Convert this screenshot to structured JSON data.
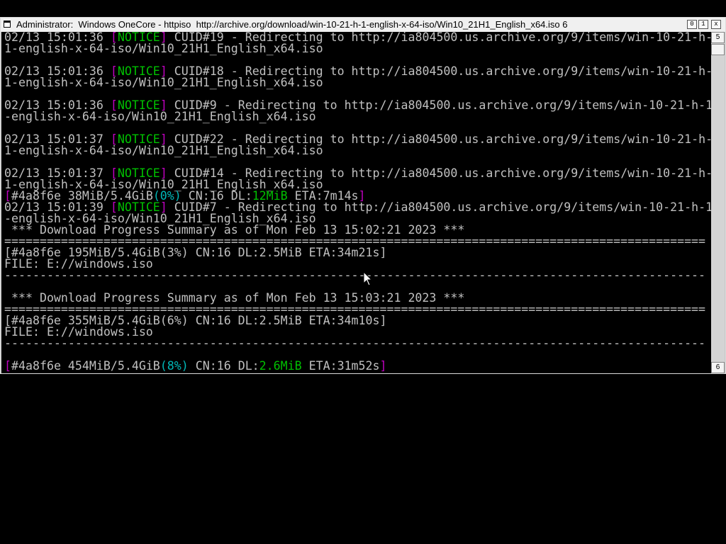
{
  "window": {
    "title": "Administrator:  Windows OneCore - httpiso  http://archive.org/download/win-10-21-h-1-english-x-64-iso/Win10_21H1_English_x64.iso 6",
    "buttons": {
      "minimize": "0",
      "maximize": "1",
      "close": "x"
    }
  },
  "scrollbar": {
    "up_glyph": "5",
    "down_glyph": "6"
  },
  "colors": {
    "bracket": "#c000c0",
    "notice": "#00c000",
    "percent": "#00b8b8",
    "text": "#c0c0c0"
  },
  "terminal": {
    "lines": [
      {
        "parts": [
          {
            "t": "02/13 15:01:36 "
          },
          {
            "t": "[",
            "c": "br"
          },
          {
            "t": "NOTICE",
            "c": "gr"
          },
          {
            "t": "]",
            "c": "br"
          },
          {
            "t": " CUID#19 - Redirecting to http://ia804500.us.archive.org/9/items/win-10-21-h-"
          }
        ]
      },
      {
        "parts": [
          {
            "t": "1-english-x-64-iso/Win10_21H1_English_x64.iso"
          }
        ]
      },
      {
        "parts": []
      },
      {
        "parts": [
          {
            "t": "02/13 15:01:36 "
          },
          {
            "t": "[",
            "c": "br"
          },
          {
            "t": "NOTICE",
            "c": "gr"
          },
          {
            "t": "]",
            "c": "br"
          },
          {
            "t": " CUID#18 - Redirecting to http://ia804500.us.archive.org/9/items/win-10-21-h-"
          }
        ]
      },
      {
        "parts": [
          {
            "t": "1-english-x-64-iso/Win10_21H1_English_x64.iso"
          }
        ]
      },
      {
        "parts": []
      },
      {
        "parts": [
          {
            "t": "02/13 15:01:36 "
          },
          {
            "t": "[",
            "c": "br"
          },
          {
            "t": "NOTICE",
            "c": "gr"
          },
          {
            "t": "]",
            "c": "br"
          },
          {
            "t": " CUID#9 - Redirecting to http://ia804500.us.archive.org/9/items/win-10-21-h-1"
          }
        ]
      },
      {
        "parts": [
          {
            "t": "-english-x-64-iso/Win10_21H1_English_x64.iso"
          }
        ]
      },
      {
        "parts": []
      },
      {
        "parts": [
          {
            "t": "02/13 15:01:37 "
          },
          {
            "t": "[",
            "c": "br"
          },
          {
            "t": "NOTICE",
            "c": "gr"
          },
          {
            "t": "]",
            "c": "br"
          },
          {
            "t": " CUID#22 - Redirecting to http://ia804500.us.archive.org/9/items/win-10-21-h-"
          }
        ]
      },
      {
        "parts": [
          {
            "t": "1-english-x-64-iso/Win10_21H1_English_x64.iso"
          }
        ]
      },
      {
        "parts": []
      },
      {
        "parts": [
          {
            "t": "02/13 15:01:37 "
          },
          {
            "t": "[",
            "c": "br"
          },
          {
            "t": "NOTICE",
            "c": "gr"
          },
          {
            "t": "]",
            "c": "br"
          },
          {
            "t": " CUID#14 - Redirecting to http://ia804500.us.archive.org/9/items/win-10-21-h-"
          }
        ]
      },
      {
        "parts": [
          {
            "t": "1-english-x-64-iso/Win10_21H1_English_x64.iso"
          }
        ]
      },
      {
        "parts": [
          {
            "t": "[",
            "c": "br"
          },
          {
            "t": "#4a8f6e 38MiB/5.4GiB"
          },
          {
            "t": "(0%)",
            "c": "cy"
          },
          {
            "t": " CN:16 DL:"
          },
          {
            "t": "12MiB",
            "c": "gr"
          },
          {
            "t": " ETA:7m14s"
          },
          {
            "t": "]",
            "c": "br"
          }
        ]
      },
      {
        "parts": [
          {
            "t": "02/13 15:01:39 "
          },
          {
            "t": "[",
            "c": "br"
          },
          {
            "t": "NOTICE",
            "c": "gr"
          },
          {
            "t": "]",
            "c": "br"
          },
          {
            "t": " CUID#7 - Redirecting to http://ia804500.us.archive.org/9/items/win-10-21-h-1"
          }
        ]
      },
      {
        "parts": [
          {
            "t": "-english-x-64-iso/Win10_21H1_English_x64.iso"
          }
        ]
      },
      {
        "parts": [
          {
            "t": " *** Download Progress Summary as of Mon Feb 13 15:02:21 2023 ***"
          }
        ]
      },
      {
        "parts": [
          {
            "t": "==================================================================================================="
          }
        ]
      },
      {
        "parts": [
          {
            "t": "[#4a8f6e 195MiB/5.4GiB(3%) CN:16 DL:2.5MiB ETA:34m21s]"
          }
        ]
      },
      {
        "parts": [
          {
            "t": "FILE: E://windows.iso"
          }
        ]
      },
      {
        "parts": [
          {
            "t": "---------------------------------------------------------------------------------------------------"
          }
        ]
      },
      {
        "parts": []
      },
      {
        "parts": [
          {
            "t": " *** Download Progress Summary as of Mon Feb 13 15:03:21 2023 ***"
          }
        ]
      },
      {
        "parts": [
          {
            "t": "==================================================================================================="
          }
        ]
      },
      {
        "parts": [
          {
            "t": "[#4a8f6e 355MiB/5.4GiB(6%) CN:16 DL:2.5MiB ETA:34m10s]"
          }
        ]
      },
      {
        "parts": [
          {
            "t": "FILE: E://windows.iso"
          }
        ]
      },
      {
        "parts": [
          {
            "t": "---------------------------------------------------------------------------------------------------"
          }
        ]
      },
      {
        "parts": []
      },
      {
        "parts": [
          {
            "t": "[",
            "c": "br"
          },
          {
            "t": "#4a8f6e 454MiB/5.4GiB"
          },
          {
            "t": "(8%)",
            "c": "cy"
          },
          {
            "t": " CN:16 DL:"
          },
          {
            "t": "2.6MiB",
            "c": "gr"
          },
          {
            "t": " ETA:31m52s"
          },
          {
            "t": "]",
            "c": "br"
          }
        ]
      }
    ]
  }
}
